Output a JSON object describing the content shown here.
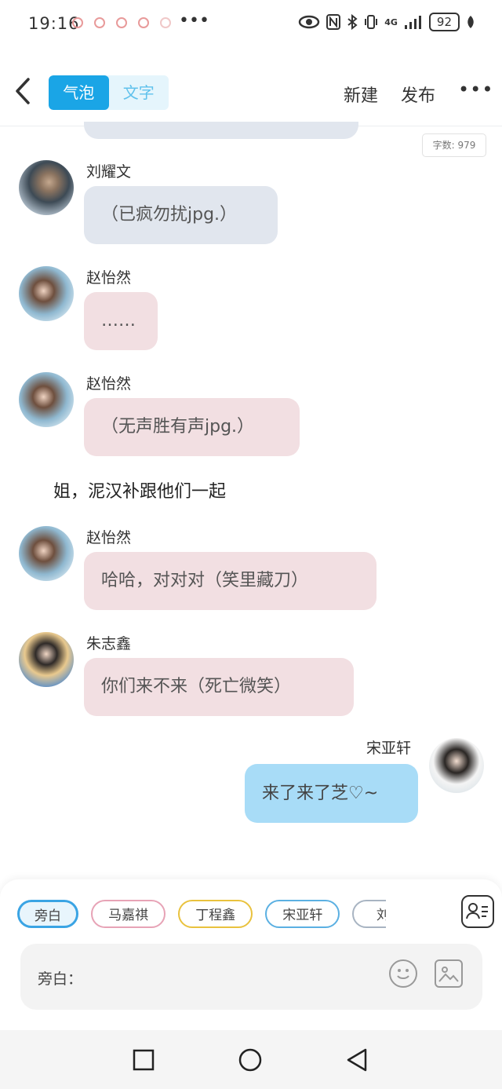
{
  "status": {
    "time": "19:16",
    "more": "•••",
    "network": "4G",
    "battery": "92"
  },
  "header": {
    "tab_bubble": "气泡",
    "tab_text": "文字",
    "new": "新建",
    "publish": "发布",
    "more": "•••"
  },
  "word_count": "字数: 979",
  "messages": [
    {
      "name": "刘耀文",
      "text": "（已疯勿扰jpg.）"
    },
    {
      "name": "赵怡然",
      "text": "……"
    },
    {
      "name": "赵怡然",
      "text": "（无声胜有声jpg.）"
    },
    {
      "narration": "姐，泥汉补跟他们一起"
    },
    {
      "name": "赵怡然",
      "text": "哈哈，对对对（笑里藏刀）"
    },
    {
      "name": "朱志鑫",
      "text": "你们来不来（死亡微笑）"
    },
    {
      "name": "宋亚轩",
      "text": "来了来了芝♡~"
    }
  ],
  "roles": [
    "旁白",
    "马嘉祺",
    "丁程鑫",
    "宋亚轩",
    "刘耀"
  ],
  "input": {
    "placeholder": "旁白："
  },
  "colors": {
    "accent": "#1aa5e6",
    "bubble_grey": "#e1e6ee",
    "bubble_pink": "#f2dfe2",
    "bubble_self": "#a8dcf7"
  }
}
